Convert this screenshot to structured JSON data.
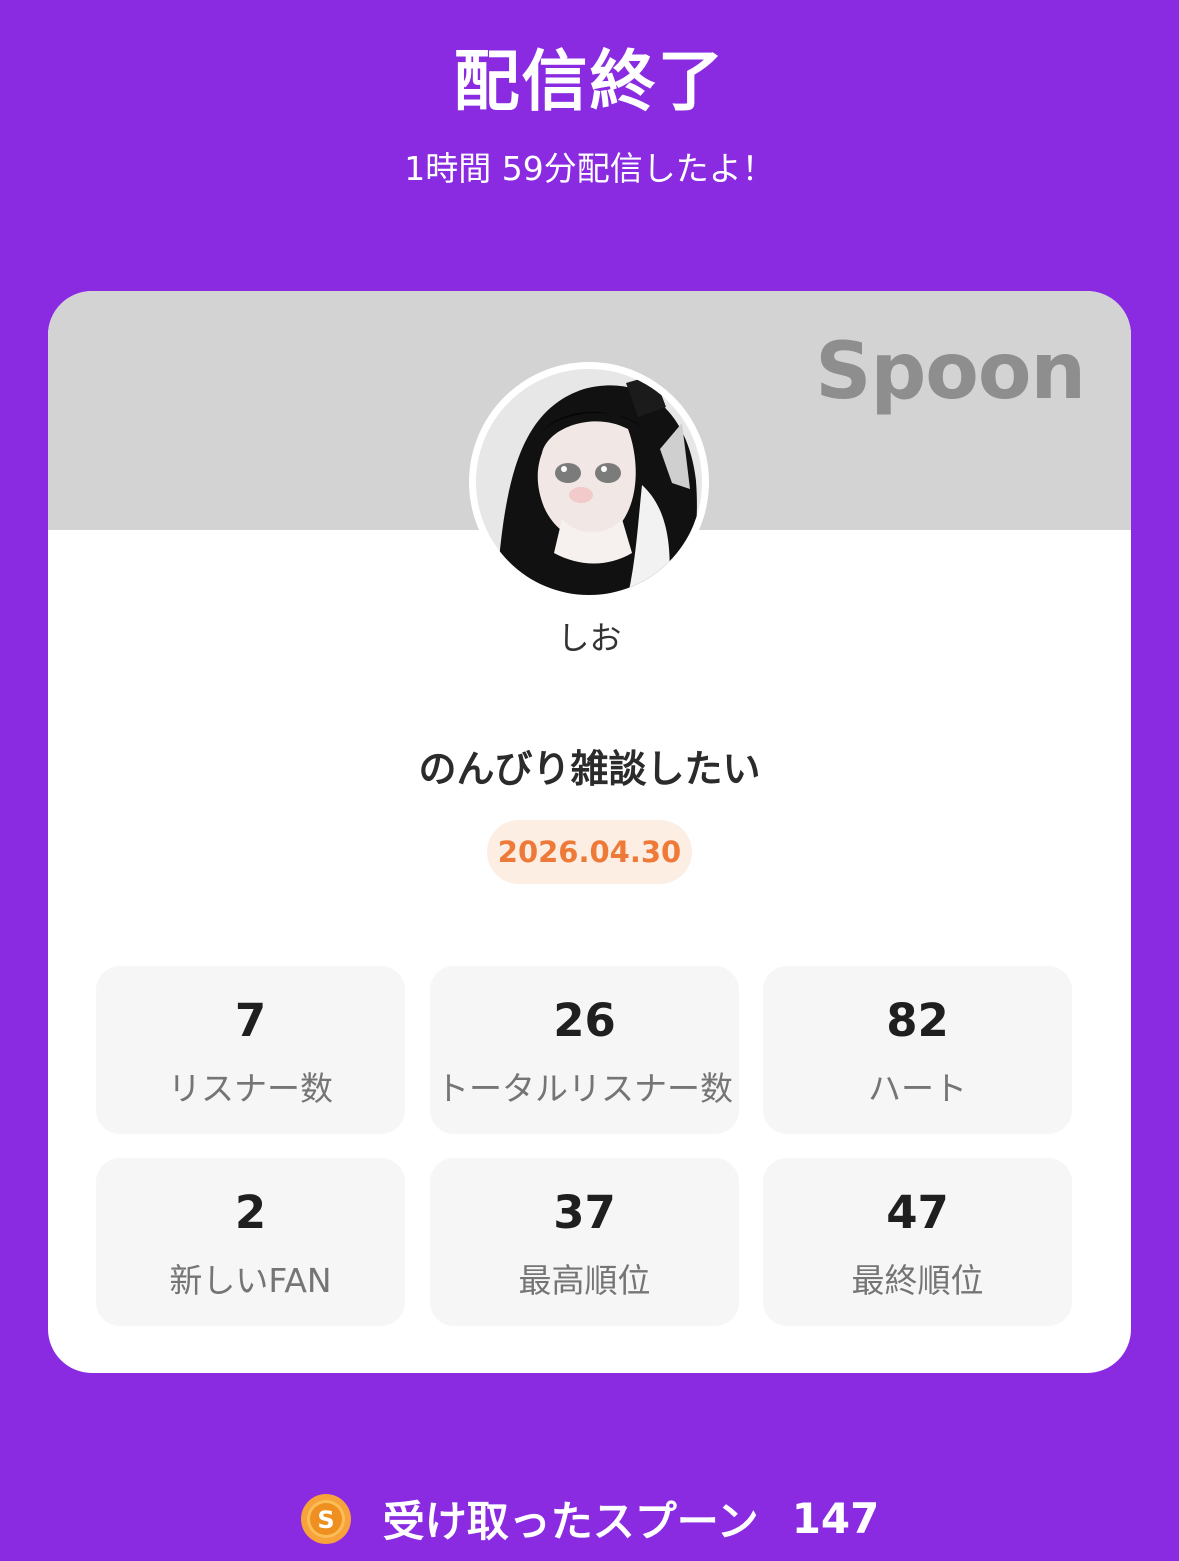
{
  "header": {
    "title": "配信終了",
    "subtitle": "1時間 59分配信したよ！"
  },
  "card": {
    "brand": "Spoon",
    "username": "しお",
    "stream_title": "のんびり雑談したい",
    "date": "2026.04.30"
  },
  "stats": [
    {
      "value": "7",
      "label": "リスナー数"
    },
    {
      "value": "26",
      "label": "トータルリスナー数"
    },
    {
      "value": "82",
      "label": "ハート"
    },
    {
      "value": "2",
      "label": "新しいFAN"
    },
    {
      "value": "37",
      "label": "最高順位"
    },
    {
      "value": "47",
      "label": "最終順位"
    }
  ],
  "footer": {
    "icon": "spoon-coin-icon",
    "label": "受け取ったスプーン",
    "value": "147"
  },
  "colors": {
    "background": "#8a2be2",
    "banner": "#d3d3d3",
    "date_text": "#ee7a3a",
    "date_badge": "#fdeee4",
    "coin": "#f7a23a"
  }
}
